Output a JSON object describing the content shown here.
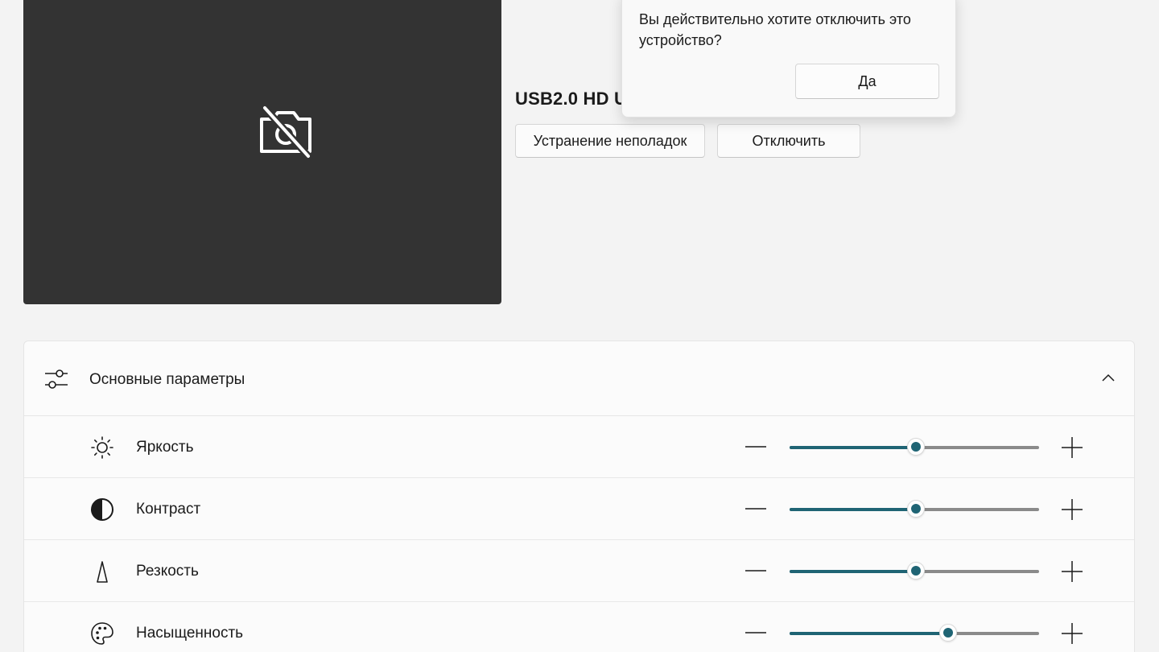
{
  "device": {
    "name": "USB2.0 HD U",
    "troubleshoot_label": "Устранение неполадок",
    "disable_label": "Отключить"
  },
  "flyout": {
    "message": "Вы действительно хотите отключить это устройство?",
    "yes_label": "Да"
  },
  "basic_settings": {
    "title": "Основные параметры",
    "rows": [
      {
        "key": "brightness",
        "label": "Яркость",
        "icon": "sun-icon",
        "level": 0.5
      },
      {
        "key": "contrast",
        "label": "Контраст",
        "icon": "half-circle-icon",
        "level": 0.5
      },
      {
        "key": "sharpness",
        "label": "Резкость",
        "icon": "sharpness-triangle-icon",
        "level": 0.5
      },
      {
        "key": "saturation",
        "label": "Насыщенность",
        "icon": "palette-icon",
        "level": 0.63
      }
    ]
  },
  "colors": {
    "accent": "#1f6474",
    "preview_bg": "#333333"
  }
}
